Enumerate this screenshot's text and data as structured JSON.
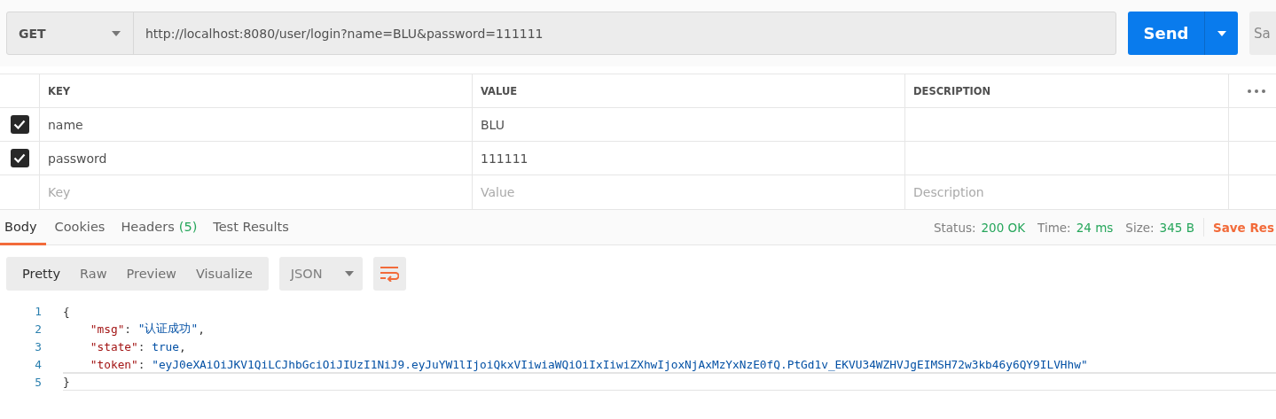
{
  "request": {
    "method": "GET",
    "url": "http://localhost:8080/user/login?name=BLU&password=111111",
    "send": "Send",
    "save": "Sa"
  },
  "params": {
    "columns": [
      "KEY",
      "VALUE",
      "DESCRIPTION"
    ],
    "rows": [
      {
        "checked": true,
        "key": "name",
        "value": "BLU",
        "description": ""
      },
      {
        "checked": true,
        "key": "password",
        "value": "111111",
        "description": ""
      }
    ],
    "new_row": {
      "key_placeholder": "Key",
      "value_placeholder": "Value",
      "description_placeholder": "Description"
    }
  },
  "response_tabs": [
    {
      "label": "Body",
      "selected": true
    },
    {
      "label": "Cookies",
      "selected": false
    },
    {
      "label": "Headers",
      "count": "(5)",
      "selected": false
    },
    {
      "label": "Test Results",
      "selected": false
    }
  ],
  "status": [
    {
      "label": "Status:",
      "value": "200 OK"
    },
    {
      "label": "Time:",
      "value": "24 ms"
    },
    {
      "label": "Size:",
      "value": "345 B"
    }
  ],
  "save_response": "Save Res",
  "view_tabs": [
    {
      "label": "Pretty",
      "selected": true
    },
    {
      "label": "Raw",
      "selected": false
    },
    {
      "label": "Preview",
      "selected": false
    },
    {
      "label": "Visualize",
      "selected": false
    }
  ],
  "format": "JSON",
  "code": [
    {
      "number": "1",
      "tokens": [
        {
          "kind": "punct",
          "text": "{"
        }
      ]
    },
    {
      "number": "2",
      "tokens": [
        {
          "kind": "key",
          "text": "    \"msg\""
        },
        {
          "kind": "punct",
          "text": ": "
        },
        {
          "kind": "string",
          "text": "\"认证成功\""
        },
        {
          "kind": "punct",
          "text": ","
        }
      ]
    },
    {
      "number": "3",
      "tokens": [
        {
          "kind": "key",
          "text": "    \"state\""
        },
        {
          "kind": "punct",
          "text": ": "
        },
        {
          "kind": "literal",
          "text": "true"
        },
        {
          "kind": "punct",
          "text": ","
        }
      ]
    },
    {
      "number": "4",
      "tokens": [
        {
          "kind": "key",
          "text": "    \"token\""
        },
        {
          "kind": "punct",
          "text": ": "
        },
        {
          "kind": "string",
          "text": "\"eyJ0eXAiOiJKV1QiLCJhbGciOiJIUzI1NiJ9.eyJuYW1lIjoiQkxVIiwiaWQiOiIxIiwiZXhwIjoxNjAxMzYxNzE0fQ.PtGd1v_EKVU34WZHVJgEIMSH72w3kb46y6QY9ILVHhw\""
        }
      ]
    },
    {
      "number": "5",
      "tokens": [
        {
          "kind": "punct",
          "text": "}"
        }
      ]
    }
  ]
}
